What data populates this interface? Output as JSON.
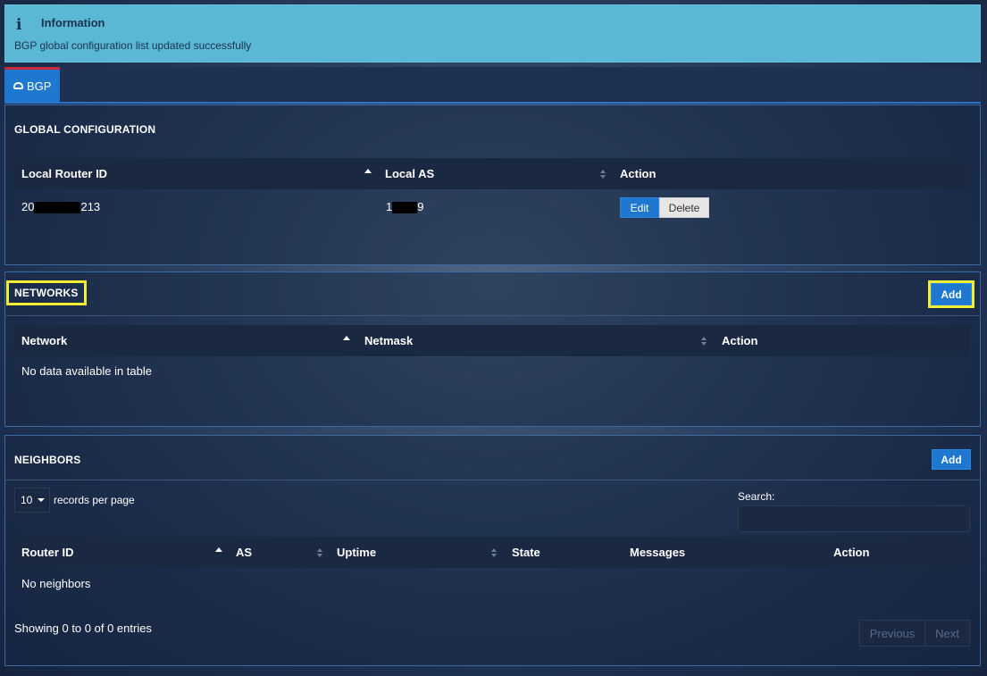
{
  "alert": {
    "title": "Information",
    "message": "BGP global configuration list updated successfully"
  },
  "tabs": [
    {
      "label": "BGP"
    }
  ],
  "global_config": {
    "title": "GLOBAL CONFIGURATION",
    "columns": [
      "Local Router ID",
      "Local AS",
      "Action"
    ],
    "row": {
      "router_id_prefix": "20",
      "router_id_suffix": "213",
      "local_as_prefix": "1",
      "local_as_suffix": "9",
      "edit_label": "Edit",
      "delete_label": "Delete"
    }
  },
  "networks": {
    "title": "NETWORKS",
    "add_label": "Add",
    "columns": [
      "Network",
      "Netmask",
      "Action"
    ],
    "empty_text": "No data available in table"
  },
  "neighbors": {
    "title": "NEIGHBORS",
    "add_label": "Add",
    "page_size": "10",
    "records_label": "records per page",
    "search_label": "Search:",
    "columns": [
      "Router ID",
      "AS",
      "Uptime",
      "State",
      "Messages",
      "Action"
    ],
    "empty_text": "No neighbors",
    "info": "Showing 0 to 0 of 0 entries",
    "previous_label": "Previous",
    "next_label": "Next"
  },
  "colors": {
    "accent": "#1f78cf",
    "alert_bg": "#5bb8d5",
    "highlight": "#f2ee33",
    "tab_top": "#c9293a"
  }
}
